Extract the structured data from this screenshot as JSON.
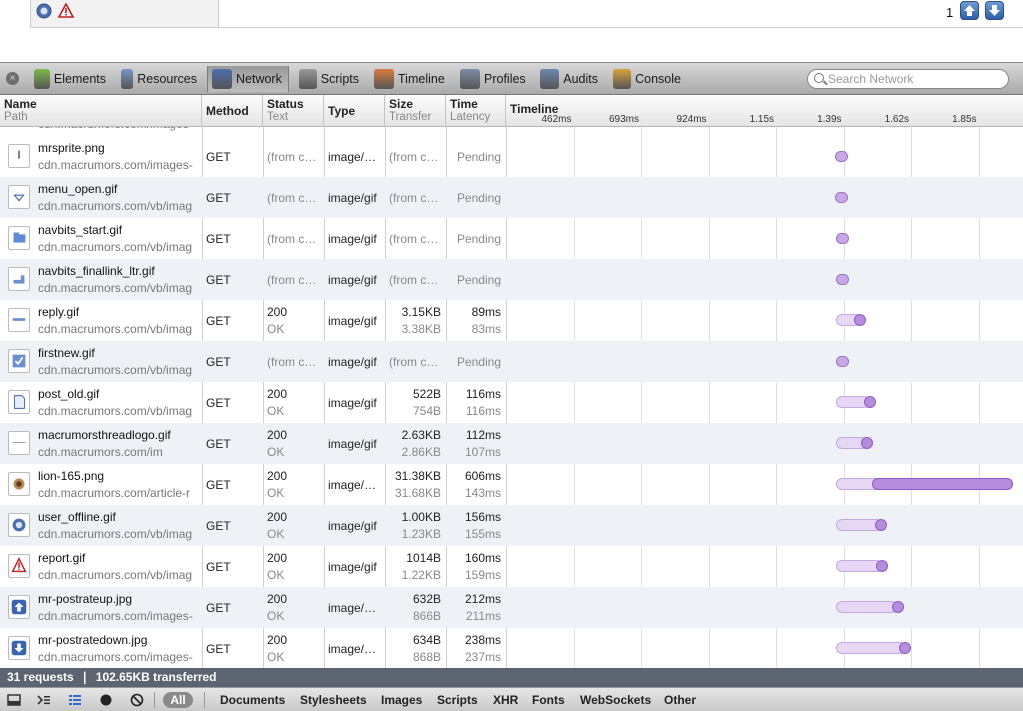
{
  "page": {
    "counter": "1"
  },
  "toolbar": {
    "tabs": [
      {
        "label": "Elements",
        "icon": "elements-icon"
      },
      {
        "label": "Resources",
        "icon": "resources-icon"
      },
      {
        "label": "Network",
        "icon": "network-icon",
        "active": true
      },
      {
        "label": "Scripts",
        "icon": "scripts-icon"
      },
      {
        "label": "Timeline",
        "icon": "timeline-icon"
      },
      {
        "label": "Profiles",
        "icon": "profiles-icon"
      },
      {
        "label": "Audits",
        "icon": "audits-icon"
      },
      {
        "label": "Console",
        "icon": "console-icon"
      }
    ],
    "search_placeholder": "Search Network"
  },
  "columns": {
    "name": "Name",
    "name_sub": "Path",
    "method": "Method",
    "status": "Status",
    "status_sub": "Text",
    "type": "Type",
    "size": "Size",
    "size_sub": "Transfer",
    "time": "Time",
    "time_sub": "Latency",
    "timeline": "Timeline",
    "ticks": [
      "462ms",
      "693ms",
      "924ms",
      "1.15s",
      "1.39s",
      "1.62s",
      "1.85s"
    ]
  },
  "partial_row_path": "cdn.macrumors.com/images-",
  "rows": [
    {
      "name": "mrsprite.png",
      "path": "cdn.macrumors.com/images-",
      "method": "GET",
      "status": "(from c…",
      "status_text": "",
      "type": "image/…",
      "size": "(from c…",
      "transfer": "",
      "time": "Pending",
      "latency": "",
      "icon": "file-icon",
      "timing": {
        "start": 1.36,
        "wait_end": null,
        "end": null
      }
    },
    {
      "name": "menu_open.gif",
      "path": "cdn.macrumors.com/vb/imag",
      "method": "GET",
      "status": "(from c…",
      "status_text": "",
      "type": "image/gif",
      "size": "(from c…",
      "transfer": "",
      "time": "Pending",
      "latency": "",
      "icon": "menu-open-icon",
      "timing": {
        "start": 1.36,
        "wait_end": null,
        "end": null
      }
    },
    {
      "name": "navbits_start.gif",
      "path": "cdn.macrumors.com/vb/imag",
      "method": "GET",
      "status": "(from c…",
      "status_text": "",
      "type": "image/gif",
      "size": "(from c…",
      "transfer": "",
      "time": "Pending",
      "latency": "",
      "icon": "folder-icon",
      "timing": {
        "start": 1.365,
        "wait_end": null,
        "end": null
      }
    },
    {
      "name": "navbits_finallink_ltr.gif",
      "path": "cdn.macrumors.com/vb/imag",
      "method": "GET",
      "status": "(from c…",
      "status_text": "",
      "type": "image/gif",
      "size": "(from c…",
      "transfer": "",
      "time": "Pending",
      "latency": "",
      "icon": "navlink-icon",
      "timing": {
        "start": 1.365,
        "wait_end": null,
        "end": null
      }
    },
    {
      "name": "reply.gif",
      "path": "cdn.macrumors.com/vb/imag",
      "method": "GET",
      "status": "200",
      "status_text": "OK",
      "type": "image/gif",
      "size": "3.15KB",
      "transfer": "3.38KB",
      "time": "89ms",
      "latency": "83ms",
      "icon": "reply-icon",
      "timing": {
        "start": 1.36,
        "wait_end": 1.443,
        "end": 1.449
      }
    },
    {
      "name": "firstnew.gif",
      "path": "cdn.macrumors.com/vb/imag",
      "method": "GET",
      "status": "(from c…",
      "status_text": "",
      "type": "image/gif",
      "size": "(from c…",
      "transfer": "",
      "time": "Pending",
      "latency": "",
      "icon": "checkbox-icon",
      "timing": {
        "start": 1.365,
        "wait_end": null,
        "end": null
      }
    },
    {
      "name": "post_old.gif",
      "path": "cdn.macrumors.com/vb/imag",
      "method": "GET",
      "status": "200",
      "status_text": "OK",
      "type": "image/gif",
      "size": "522B",
      "transfer": "754B",
      "time": "116ms",
      "latency": "116ms",
      "icon": "post-icon",
      "timing": {
        "start": 1.36,
        "wait_end": 1.476,
        "end": 1.476
      }
    },
    {
      "name": "macrumorsthreadlogo.gif",
      "path": "cdn.macrumors.com/im",
      "method": "GET",
      "status": "200",
      "status_text": "OK",
      "type": "image/gif",
      "size": "2.63KB",
      "transfer": "2.86KB",
      "time": "112ms",
      "latency": "107ms",
      "icon": "logo-icon",
      "timing": {
        "start": 1.36,
        "wait_end": 1.467,
        "end": 1.472
      }
    },
    {
      "name": "lion-165.png",
      "path": "cdn.macrumors.com/article-r",
      "method": "GET",
      "status": "200",
      "status_text": "OK",
      "type": "image/…",
      "size": "31.38KB",
      "transfer": "31.68KB",
      "time": "606ms",
      "latency": "143ms",
      "icon": "lion-icon",
      "timing": {
        "start": 1.36,
        "wait_end": 1.503,
        "end": 1.966
      }
    },
    {
      "name": "user_offline.gif",
      "path": "cdn.macrumors.com/vb/imag",
      "method": "GET",
      "status": "200",
      "status_text": "OK",
      "type": "image/gif",
      "size": "1.00KB",
      "transfer": "1.23KB",
      "time": "156ms",
      "latency": "155ms",
      "icon": "user-offline-icon",
      "timing": {
        "start": 1.36,
        "wait_end": 1.515,
        "end": 1.516
      }
    },
    {
      "name": "report.gif",
      "path": "cdn.macrumors.com/vb/imag",
      "method": "GET",
      "status": "200",
      "status_text": "OK",
      "type": "image/gif",
      "size": "1014B",
      "transfer": "1.22KB",
      "time": "160ms",
      "latency": "159ms",
      "icon": "report-icon",
      "timing": {
        "start": 1.36,
        "wait_end": 1.519,
        "end": 1.52
      }
    },
    {
      "name": "mr-postrateup.jpg",
      "path": "cdn.macrumors.com/images-",
      "method": "GET",
      "status": "200",
      "status_text": "OK",
      "type": "image/…",
      "size": "632B",
      "transfer": "866B",
      "time": "212ms",
      "latency": "211ms",
      "icon": "rate-up-icon",
      "timing": {
        "start": 1.36,
        "wait_end": 1.571,
        "end": 1.572
      }
    },
    {
      "name": "mr-postratedown.jpg",
      "path": "cdn.macrumors.com/images-",
      "method": "GET",
      "status": "200",
      "status_text": "OK",
      "type": "image/…",
      "size": "634B",
      "transfer": "868B",
      "time": "238ms",
      "latency": "237ms",
      "icon": "rate-down-icon",
      "timing": {
        "start": 1.36,
        "wait_end": 1.597,
        "end": 1.598
      }
    }
  ],
  "status": {
    "requests": "31 requests",
    "separator": "❘",
    "transferred": "102.65KB transferred"
  },
  "filters": {
    "all": "All",
    "items": [
      "Documents",
      "Stylesheets",
      "Images",
      "Scripts",
      "XHR",
      "Fonts",
      "WebSockets",
      "Other"
    ]
  },
  "colors": {
    "accent": "#9d70c8",
    "status_bar": "#5b6470"
  }
}
